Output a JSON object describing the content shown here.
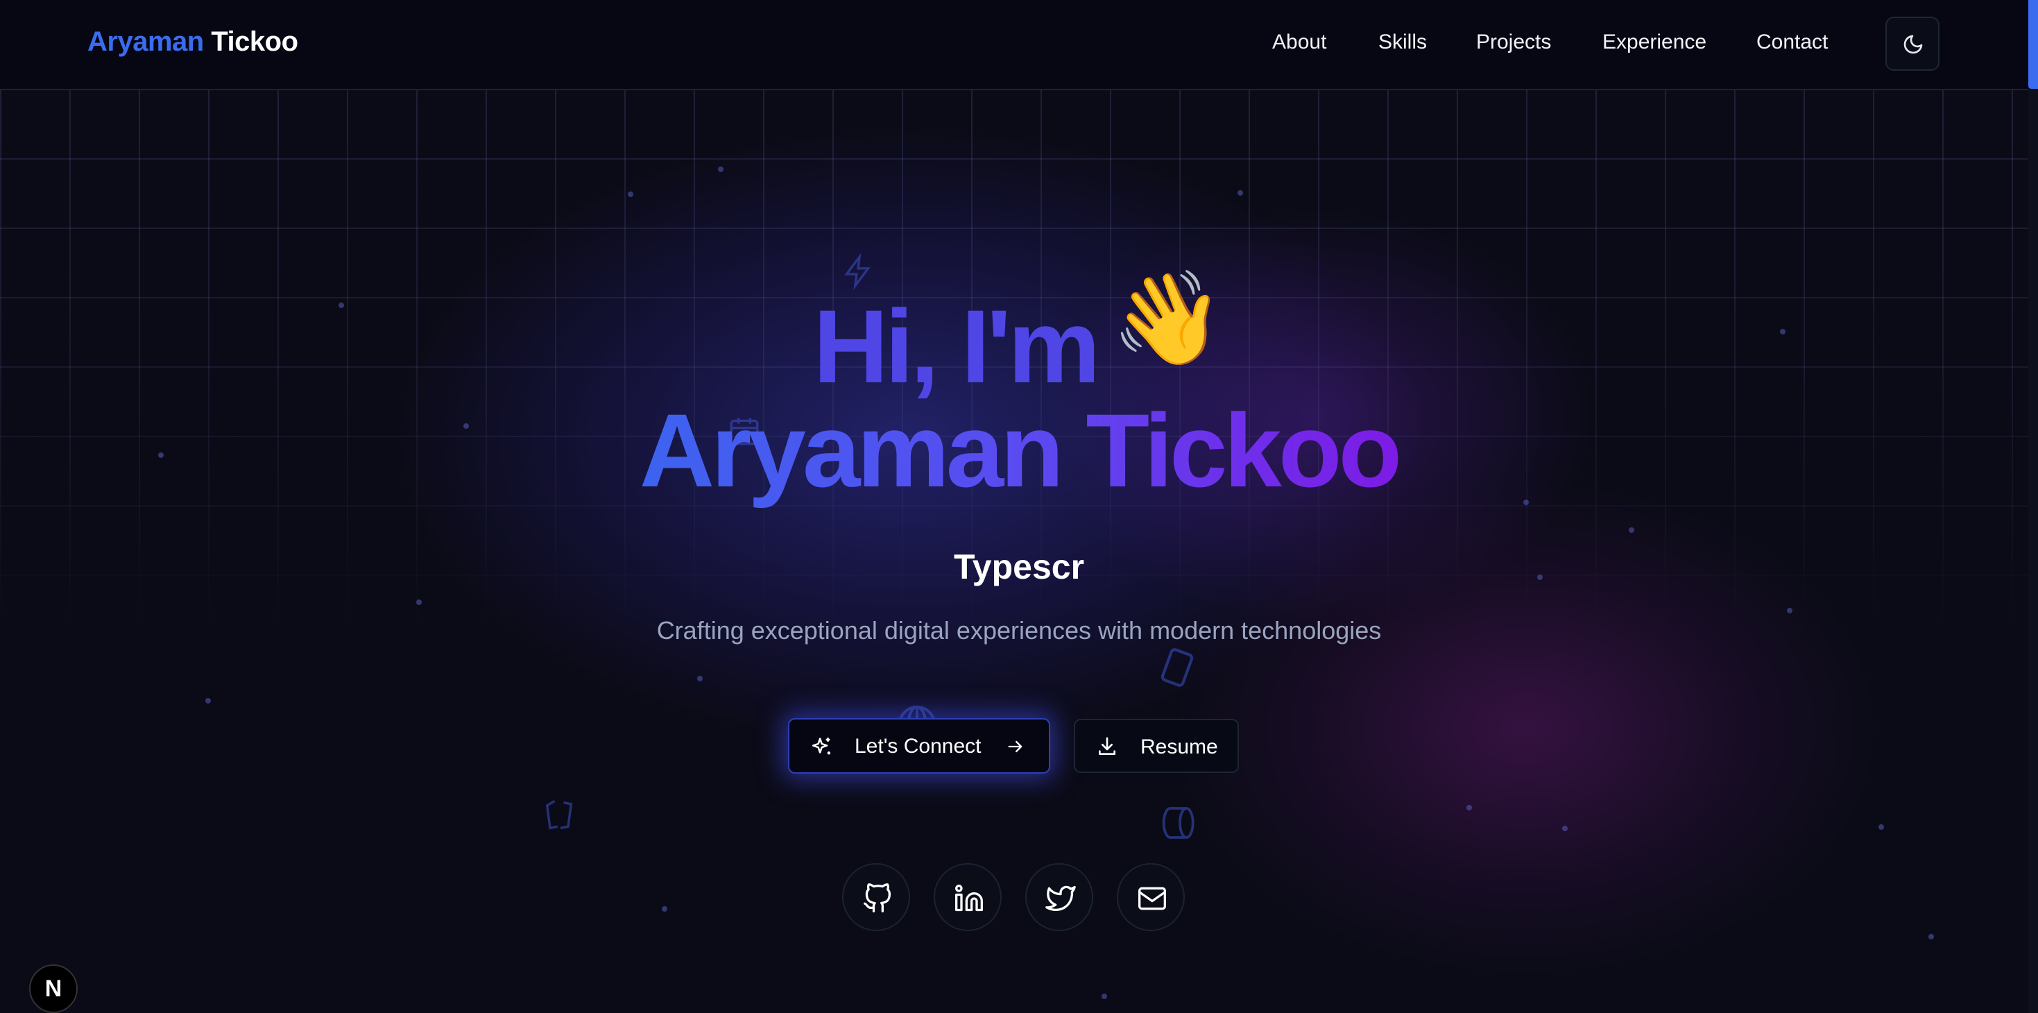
{
  "header": {
    "brand_first": "Aryaman",
    "brand_last": "Tickoo",
    "nav": [
      "About",
      "Skills",
      "Projects",
      "Experience",
      "Contact"
    ],
    "theme_toggle_icon": "moon-icon"
  },
  "hero": {
    "greeting": "Hi, I'm",
    "wave_emoji": "👋",
    "name": "Aryaman Tickoo",
    "role_typed": "Typescr",
    "tagline": "Crafting exceptional digital experiences with modern technologies"
  },
  "buttons": {
    "connect_label": "Let's Connect",
    "connect_icons": [
      "sparkles-icon",
      "arrow-right-icon"
    ],
    "resume_label": "Resume",
    "resume_icon": "download-icon"
  },
  "social": [
    "github-icon",
    "linkedin-icon",
    "twitter-icon",
    "mail-icon"
  ],
  "badge": {
    "label": "N"
  },
  "colors": {
    "accent_blue": "#3b6cf0",
    "accent_indigo": "#4f46e5",
    "accent_purple": "#7d1be6",
    "background": "#0b0b17",
    "muted_text": "#9aa4bf"
  }
}
